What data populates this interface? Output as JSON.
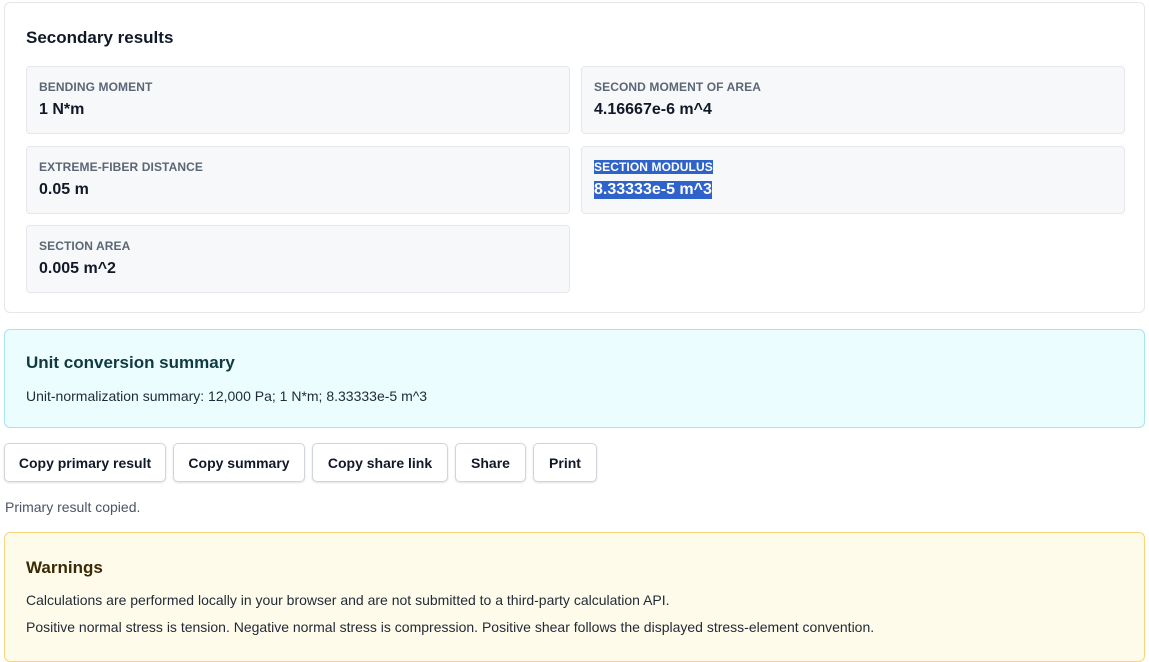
{
  "secondary": {
    "title": "Secondary results",
    "items": [
      {
        "label": "BENDING MOMENT",
        "value": "1 N*m"
      },
      {
        "label": "SECOND MOMENT OF AREA",
        "value": "4.16667e-6 m^4"
      },
      {
        "label": "EXTREME-FIBER DISTANCE",
        "value": "0.05 m"
      },
      {
        "label": "SECTION MODULUS",
        "value": "8.33333e-5 m^3",
        "selected": true
      },
      {
        "label": "SECTION AREA",
        "value": "0.005 m^2"
      }
    ]
  },
  "conversion": {
    "title": "Unit conversion summary",
    "text": "Unit-normalization summary: 12,000 Pa; 1 N*m; 8.33333e-5 m^3"
  },
  "actions": {
    "copy_primary": "Copy primary result",
    "copy_summary": "Copy summary",
    "copy_share_link": "Copy share link",
    "share": "Share",
    "print": "Print"
  },
  "status": "Primary result copied.",
  "warnings": {
    "title": "Warnings",
    "items": [
      "Calculations are performed locally in your browser and are not submitted to a third-party calculation API.",
      "Positive normal stress is tension. Negative normal stress is compression. Positive shear follows the displayed stress-element convention."
    ]
  },
  "colors": {
    "selection_highlight": "#2f63c9",
    "info_background": "#ecfdff",
    "warning_background": "#fffbea"
  }
}
